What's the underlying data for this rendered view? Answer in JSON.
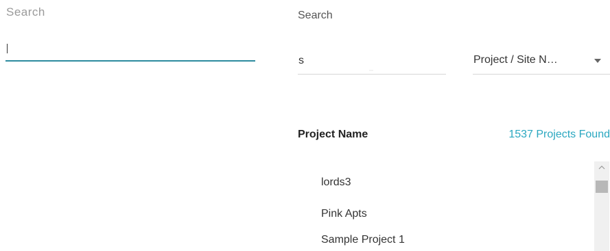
{
  "left_panel": {
    "label": "Search",
    "input_value": ""
  },
  "search": {
    "label": "Search",
    "query": "s",
    "filter_selected": "Project / Site N…"
  },
  "results": {
    "column_header": "Project Name",
    "count_text": "1537 Projects Found",
    "items": [
      {
        "name": "lords3"
      },
      {
        "name": "Pink Apts"
      },
      {
        "name": "Sample Project 1"
      }
    ]
  },
  "colors": {
    "accent": "#2aa7c0",
    "underline_active": "#2b8a9e"
  },
  "icons": {
    "dropdown": "chevron-down-icon",
    "scroll_up": "chevron-up-icon"
  }
}
